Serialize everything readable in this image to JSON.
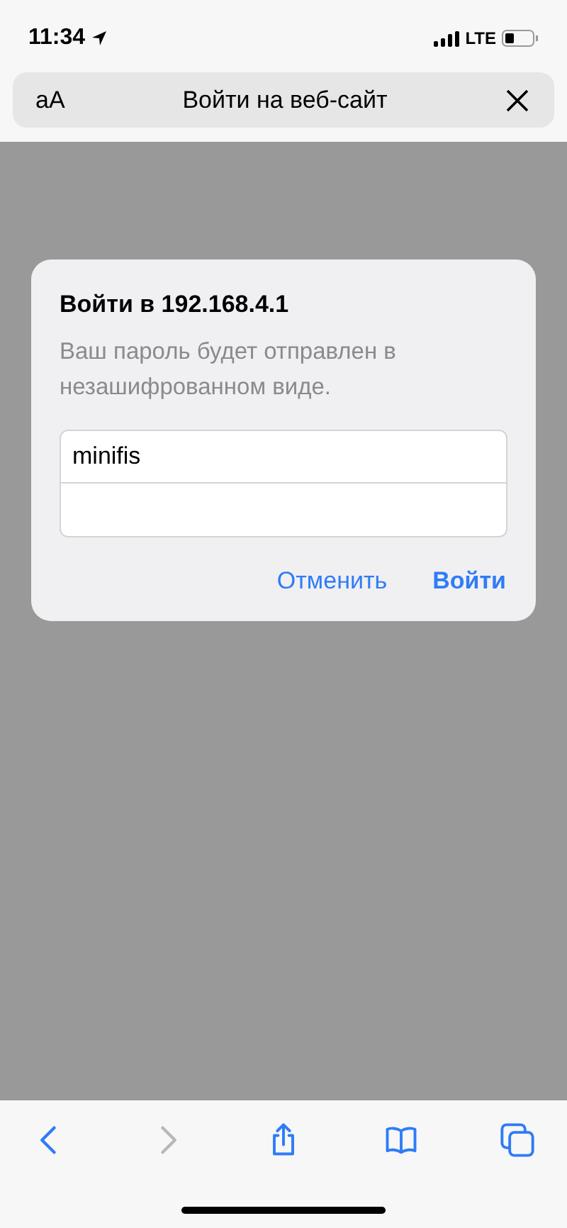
{
  "status_bar": {
    "time": "11:34",
    "network": "LTE"
  },
  "address_bar": {
    "text_size_button": "aA",
    "title": "Войти на веб-сайт"
  },
  "dialog": {
    "title": "Войти в 192.168.4.1",
    "message": "Ваш пароль будет отправлен в незашифрованном виде.",
    "fields": [
      {
        "kind": "username",
        "value": "minifis"
      },
      {
        "kind": "password"
      }
    ],
    "buttons": [
      {
        "label": "Отменить",
        "default": false
      },
      {
        "label": "Войти",
        "default": true
      }
    ]
  },
  "toolbar": [
    {
      "kind": "back",
      "disabled": false
    },
    {
      "kind": "forward",
      "disabled": true
    },
    {
      "kind": "share",
      "disabled": false
    },
    {
      "kind": "bookmarks",
      "disabled": false
    },
    {
      "kind": "tabs",
      "disabled": false
    }
  ]
}
